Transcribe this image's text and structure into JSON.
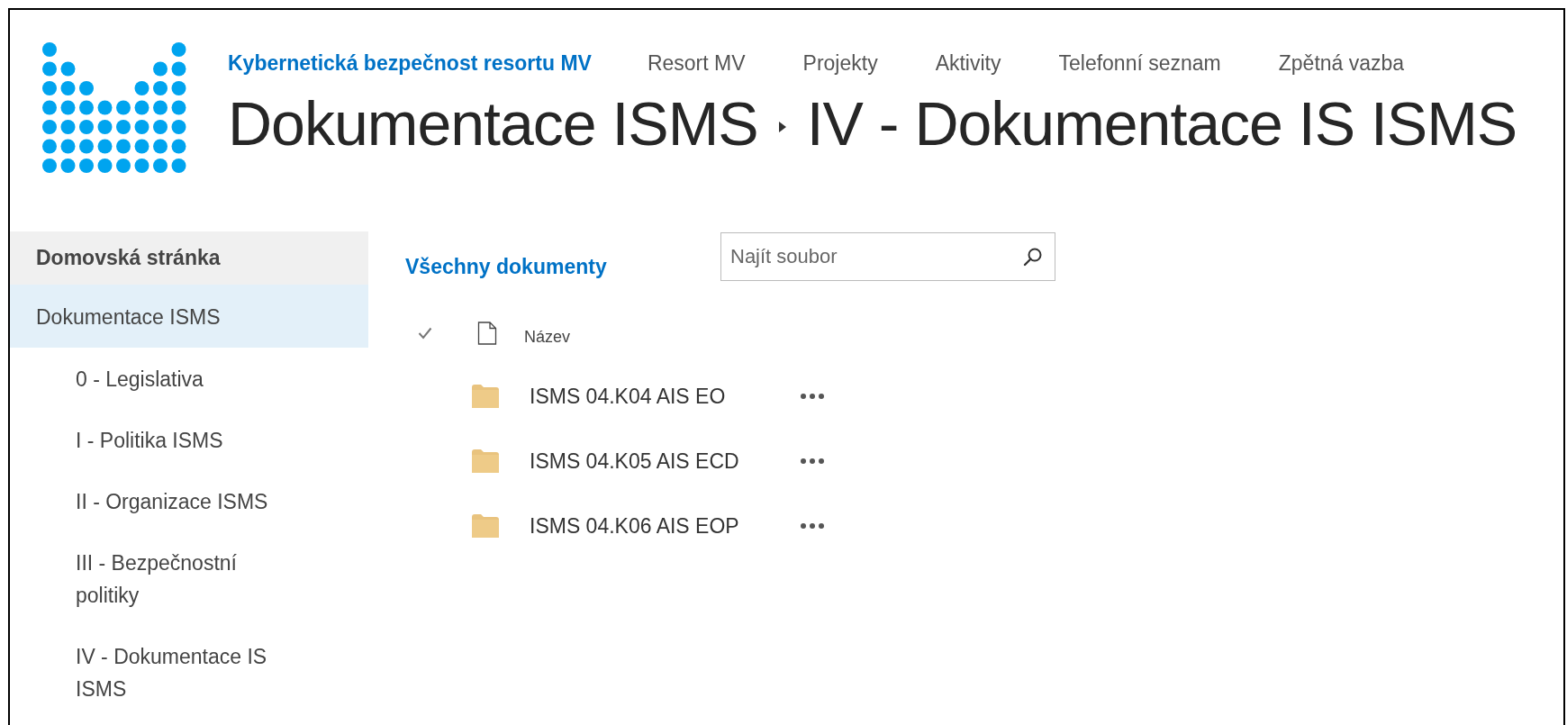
{
  "site_title": "Kybernetická bezpečnost resortu MV",
  "top_nav": [
    {
      "label": "Resort MV"
    },
    {
      "label": "Projekty"
    },
    {
      "label": "Aktivity"
    },
    {
      "label": "Telefonní seznam"
    },
    {
      "label": "Zpětná vazba"
    }
  ],
  "breadcrumb": [
    "Dokumentace ISMS",
    "IV - Dokumentace IS ISMS"
  ],
  "sidebar": {
    "items": [
      {
        "label": "Domovská stránka",
        "kind": "heading",
        "selected": false
      },
      {
        "label": "Dokumentace ISMS",
        "kind": "link",
        "selected": true,
        "children": [
          {
            "label": "0 - Legislativa",
            "selected": false
          },
          {
            "label": "I - Politika ISMS",
            "selected": false
          },
          {
            "label": "II - Organizace ISMS",
            "selected": false
          },
          {
            "label": "III - Bezpečnostní politiky",
            "selected": false
          },
          {
            "label": "IV - Dokumentace IS ISMS",
            "selected": false
          }
        ]
      }
    ]
  },
  "view": {
    "label": "Všechny dokumenty",
    "selected": true
  },
  "search": {
    "placeholder": "Najít soubor"
  },
  "table": {
    "columns": [
      {
        "label": "Název"
      }
    ],
    "rows": [
      {
        "name": "ISMS 04.K04 AIS EO"
      },
      {
        "name": "ISMS 04.K05 AIS ECD"
      },
      {
        "name": "ISMS 04.K06 AIS EOP"
      }
    ]
  }
}
